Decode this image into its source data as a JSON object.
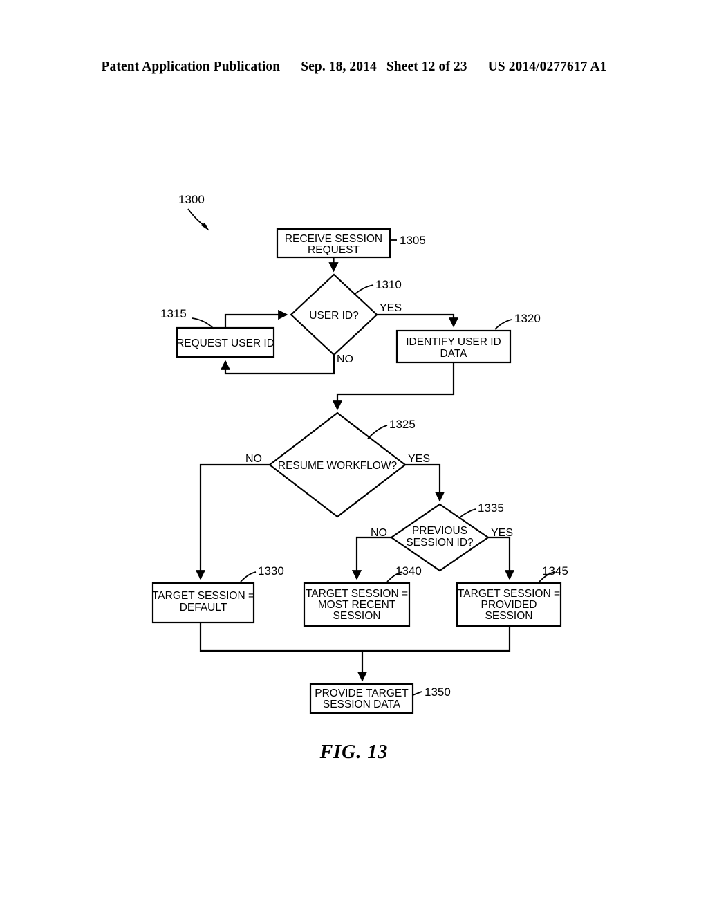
{
  "header": {
    "publication": "Patent Application Publication",
    "date": "Sep. 18, 2014",
    "sheet": "Sheet 12 of 23",
    "patent_number": "US 2014/0277617 A1"
  },
  "figure": {
    "caption": "FIG. 13",
    "diagram_ref": "1300"
  },
  "nodes": {
    "n1305": {
      "ref": "1305",
      "line1": "RECEIVE SESSION",
      "line2": "REQUEST"
    },
    "n1310": {
      "ref": "1310",
      "line1": "USER ID?"
    },
    "n1315": {
      "ref": "1315",
      "line1": "REQUEST USER ID"
    },
    "n1320": {
      "ref": "1320",
      "line1": "IDENTIFY USER ID",
      "line2": "DATA"
    },
    "n1325": {
      "ref": "1325",
      "line1": "RESUME WORKFLOW?"
    },
    "n1330": {
      "ref": "1330",
      "line1": "TARGET SESSION =",
      "line2": "DEFAULT"
    },
    "n1335": {
      "ref": "1335",
      "line1": "PREVIOUS",
      "line2": "SESSION ID?"
    },
    "n1340": {
      "ref": "1340",
      "line1": "TARGET SESSION =",
      "line2": "MOST RECENT",
      "line3": "SESSION"
    },
    "n1345": {
      "ref": "1345",
      "line1": "TARGET SESSION =",
      "line2": "PROVIDED",
      "line3": "SESSION"
    },
    "n1350": {
      "ref": "1350",
      "line1": "PROVIDE TARGET",
      "line2": "SESSION DATA"
    }
  },
  "branches": {
    "userid_yes": "YES",
    "userid_no": "NO",
    "resume_no": "NO",
    "resume_yes": "YES",
    "prev_no": "NO",
    "prev_yes": "YES"
  },
  "colors": {
    "ink": "#000000",
    "paper": "#ffffff"
  }
}
